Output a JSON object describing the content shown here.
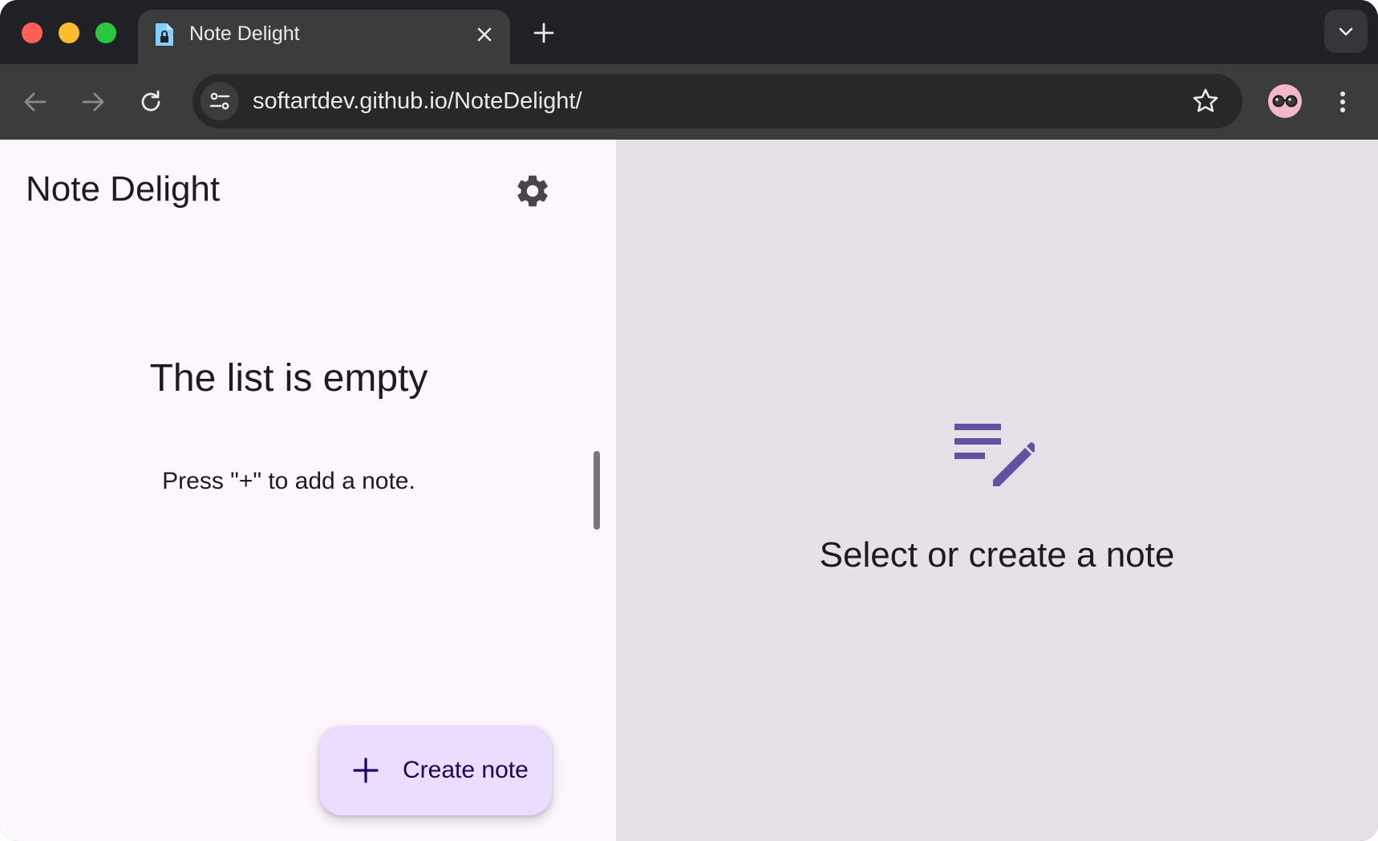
{
  "browser": {
    "tab": {
      "title": "Note Delight",
      "favicon": "document-lock-icon"
    },
    "new_tab": "plus-icon",
    "address_bar": {
      "url": "softartdev.github.io/NoteDelight/"
    }
  },
  "app": {
    "title": "Note Delight",
    "settings_icon": "gear-icon",
    "empty_state": {
      "title": "The list is empty",
      "subtitle": "Press \"+\" to add a note."
    },
    "fab": {
      "icon": "plus-icon",
      "label": "Create note"
    },
    "detail_placeholder": {
      "icon": "edit-note-icon",
      "text": "Select or create a note"
    }
  },
  "colors": {
    "accent": "#6750a4",
    "fab_background": "#eaddff",
    "list_background": "#fdf7fd",
    "detail_background": "#e6e0e9"
  }
}
